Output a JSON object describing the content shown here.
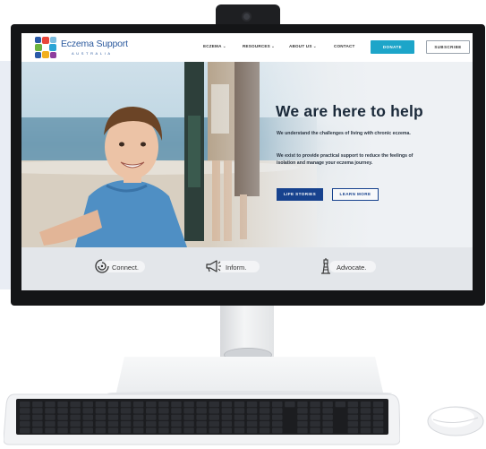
{
  "site": {
    "logo_name": "Eczema Support",
    "logo_country": "AUSTRALIA",
    "nav": [
      "ECZEMA",
      "RESOURCES",
      "ABOUT US",
      "CONTACT"
    ],
    "donate_label": "DONATE",
    "subscribe_label": "SUBSCRIBE"
  },
  "hero": {
    "title": "We are here to help",
    "paragraph_1": "We understand the challenges of living with chronic eczema.",
    "paragraph_2": "We exist to provide practical support to reduce the feelings of isolation and manage your eczema journey.",
    "primary_button": "LIFE STORIES",
    "secondary_button": "LEARN MORE"
  },
  "features": [
    {
      "label": "Connect.",
      "icon": "connect-swirl-icon"
    },
    {
      "label": "Inform.",
      "icon": "megaphone-icon"
    },
    {
      "label": "Advocate.",
      "icon": "lighthouse-icon"
    }
  ],
  "colors": {
    "brand_blue": "#2c5a9e",
    "donate_teal": "#1da5c9",
    "primary_navy": "#17428e",
    "feature_strip": "#e3e6ea"
  }
}
